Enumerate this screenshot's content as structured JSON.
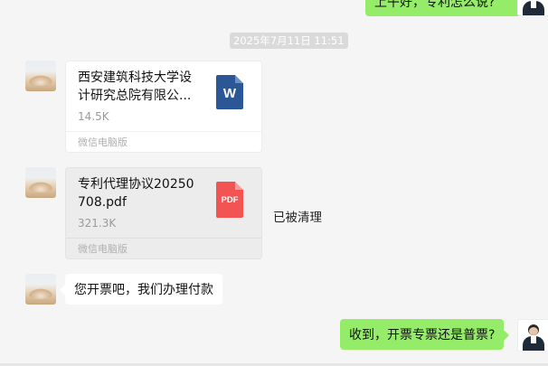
{
  "messages": {
    "top_partial_text": "上午好，专利怎么说?",
    "timestamp": "2025年7月11日 11:51",
    "file1": {
      "name": "西安建筑科技大学设计研究总院有限公...",
      "size": "14.5K",
      "source": "微信电脑版",
      "icon_letter": "W",
      "icon": "word-doc-icon"
    },
    "file2": {
      "name": "专利代理协议20250708.pdf",
      "size": "321.3K",
      "source": "微信电脑版",
      "icon_letter": "PDF",
      "icon": "pdf-icon",
      "status": "已被清理"
    },
    "text_left": "您开票吧，我们办理付款",
    "text_right": "收到，开票专票还是普票?"
  },
  "colors": {
    "background": "#f5f5f5",
    "bubble_self": "#95ec69",
    "bubble_other": "#ffffff",
    "word_blue": "#2b5797",
    "pdf_red": "#f25353"
  }
}
